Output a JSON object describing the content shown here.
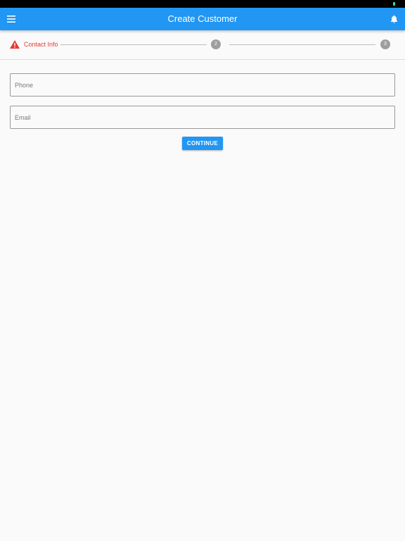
{
  "app_bar": {
    "title": "Create Customer",
    "menu_icon": "menu-icon",
    "notification_icon": "bell-icon",
    "color": "#2196f3"
  },
  "stepper": {
    "steps": [
      {
        "label": "Contact Info",
        "state": "error",
        "icon": "warning-icon"
      },
      {
        "label": "2",
        "state": "inactive"
      },
      {
        "label": "3",
        "state": "inactive"
      }
    ],
    "error_color": "#e53935",
    "inactive_color": "#9e9e9e"
  },
  "form": {
    "phone": {
      "placeholder": "Phone",
      "value": ""
    },
    "email": {
      "placeholder": "Email",
      "value": ""
    },
    "continue_label": "CONTINUE"
  }
}
